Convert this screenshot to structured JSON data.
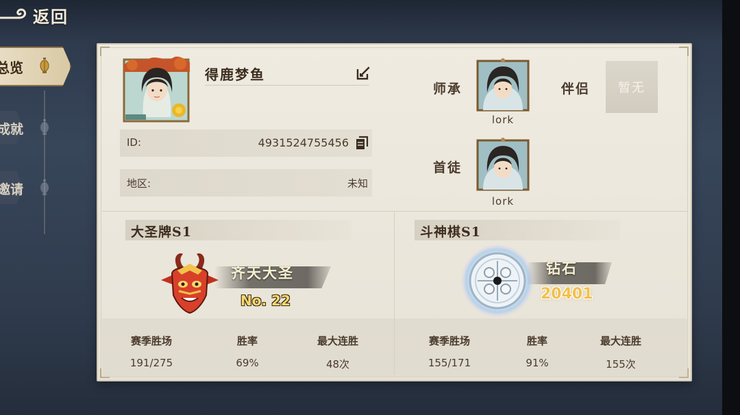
{
  "nav": {
    "back_label": "返回"
  },
  "tabs": [
    {
      "label": "总览",
      "active": true
    },
    {
      "label": "成就",
      "active": false
    },
    {
      "label": "邀请",
      "active": false
    }
  ],
  "profile": {
    "name": "得鹿梦鱼",
    "id_label": "ID:",
    "id_value": "4931524755456",
    "region_label": "地区:",
    "region_value": "未知"
  },
  "relations": {
    "master_label": "师承",
    "master_name": "lork",
    "partner_label": "伴侣",
    "partner_value": "暂无",
    "disciple_label": "首徒",
    "disciple_name": "lork"
  },
  "modes": [
    {
      "title": "大圣牌S1",
      "rank_title": "齐天大圣",
      "rank_value": "No. 22",
      "stats": [
        {
          "label": "赛季胜场",
          "value": "191/275"
        },
        {
          "label": "胜率",
          "value": "69%"
        },
        {
          "label": "最大连胜",
          "value": "48次"
        }
      ]
    },
    {
      "title": "斗神棋S1",
      "rank_title": "钻石",
      "rank_value": "20401",
      "stats": [
        {
          "label": "赛季胜场",
          "value": "155/171"
        },
        {
          "label": "胜率",
          "value": "91%"
        },
        {
          "label": "最大连胜",
          "value": "155次"
        }
      ]
    }
  ],
  "colors": {
    "background": "#313d50",
    "panel": "#ece8de",
    "text_dark": "#4a3b2d",
    "rank_gold": "#f6d870",
    "score_gold": "#f2c04c"
  }
}
